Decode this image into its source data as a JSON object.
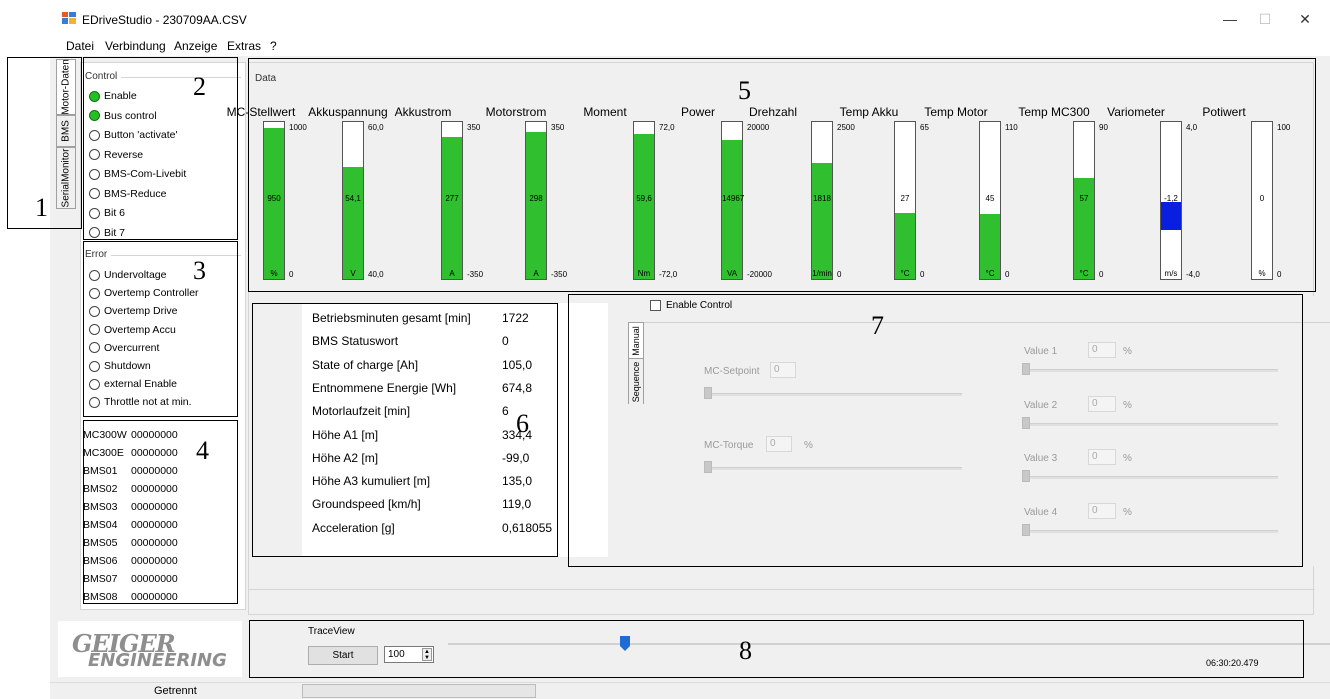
{
  "window": {
    "title": "EDriveStudio - 230709AA.CSV"
  },
  "window_controls": {
    "minimize": "—",
    "maximize": "☐",
    "close": "✕"
  },
  "menu": [
    "Datei",
    "Verbindung",
    "Anzeige",
    "Extras",
    "?"
  ],
  "side_tabs": [
    "Motor-Daten",
    "BMS",
    "SerialMonitor"
  ],
  "control": {
    "title": "Control",
    "items": [
      {
        "label": "Enable",
        "on": true
      },
      {
        "label": "Bus control",
        "on": true
      },
      {
        "label": "Button 'activate'",
        "on": false
      },
      {
        "label": "Reverse",
        "on": false
      },
      {
        "label": "BMS-Com-Livebit",
        "on": false
      },
      {
        "label": "BMS-Reduce",
        "on": false
      },
      {
        "label": "Bit 6",
        "on": false
      },
      {
        "label": "Bit 7",
        "on": false
      }
    ]
  },
  "error": {
    "title": "Error",
    "items": [
      "Undervoltage",
      "Overtemp Controller",
      "Overtemp Drive",
      "Overtemp Accu",
      "Overcurrent",
      "Shutdown",
      "external Enable",
      "Throttle not at min."
    ]
  },
  "registers": [
    {
      "name": "MC300W",
      "value": "00000000"
    },
    {
      "name": "MC300E",
      "value": "00000000"
    },
    {
      "name": "BMS01",
      "value": "00000000"
    },
    {
      "name": "BMS02",
      "value": "00000000"
    },
    {
      "name": "BMS03",
      "value": "00000000"
    },
    {
      "name": "BMS04",
      "value": "00000000"
    },
    {
      "name": "BMS05",
      "value": "00000000"
    },
    {
      "name": "BMS06",
      "value": "00000000"
    },
    {
      "name": "BMS07",
      "value": "00000000"
    },
    {
      "name": "BMS08",
      "value": "00000000"
    }
  ],
  "data_panel": {
    "title": "Data",
    "gauges": [
      {
        "label": "MC-Stellwert",
        "max": "1000",
        "min": "0",
        "value": "950",
        "unit": "%",
        "fraction": 0.95
      },
      {
        "label": "Akkuspannung",
        "max": "60,0",
        "min": "40,0",
        "value": "54,1",
        "unit": "V",
        "fraction": 0.705
      },
      {
        "label": "Akkustrom",
        "max": "350",
        "min": "-350",
        "value": "277",
        "unit": "A",
        "fraction": 0.896
      },
      {
        "label": "Motorstrom",
        "max": "350",
        "min": "-350",
        "value": "298",
        "unit": "A",
        "fraction": 0.926
      },
      {
        "label": "Moment",
        "max": "72,0",
        "min": "-72,0",
        "value": "59,6",
        "unit": "Nm",
        "fraction": 0.914
      },
      {
        "label": "Power",
        "max": "20000",
        "min": "-20000",
        "value": "14967",
        "unit": "VA",
        "fraction": 0.874
      },
      {
        "label": "Drehzahl",
        "max": "2500",
        "min": "0",
        "value": "1818",
        "unit": "1/min",
        "fraction": 0.727
      },
      {
        "label": "Temp Akku",
        "max": "65",
        "min": "0",
        "value": "27",
        "unit": "°C",
        "fraction": 0.415
      },
      {
        "label": "Temp Motor",
        "max": "110",
        "min": "0",
        "value": "45",
        "unit": "°C",
        "fraction": 0.409
      },
      {
        "label": "Temp MC300",
        "max": "90",
        "min": "0",
        "value": "57",
        "unit": "°C",
        "fraction": 0.633
      },
      {
        "label": "Variometer",
        "max": "4,0",
        "min": "-4,0",
        "value": "-1,2",
        "unit": "m/s",
        "fraction": -0.3
      },
      {
        "label": "Potiwert",
        "max": "100",
        "min": "0",
        "value": "0",
        "unit": "%",
        "fraction": 0
      }
    ]
  },
  "info": [
    {
      "label": "Betriebsminuten gesamt [min]",
      "value": "1722"
    },
    {
      "label": "BMS Statuswort",
      "value": "0"
    },
    {
      "label": "State of charge [Ah]",
      "value": "105,0"
    },
    {
      "label": "Entnommene Energie [Wh]",
      "value": "674,8"
    },
    {
      "label": "Motorlaufzeit [min]",
      "value": "6"
    },
    {
      "label": "Höhe A1 [m]",
      "value": "334,4"
    },
    {
      "label": "Höhe A2 [m]",
      "value": "-99,0"
    },
    {
      "label": "Höhe A3 kumuliert [m]",
      "value": "135,0"
    },
    {
      "label": "Groundspeed [km/h]",
      "value": "119,0"
    },
    {
      "label": "Acceleration [g]",
      "value": "0,618055"
    }
  ],
  "control_panel": {
    "enable_label": "Enable Control",
    "tabs": [
      "Manual",
      "Sequence"
    ],
    "mc_setpoint": {
      "label": "MC-Setpoint",
      "value": "0"
    },
    "mc_torque": {
      "label": "MC-Torque",
      "value": "0",
      "unit": "%"
    },
    "values": [
      {
        "label": "Value 1",
        "value": "0",
        "unit": "%"
      },
      {
        "label": "Value 2",
        "value": "0",
        "unit": "%"
      },
      {
        "label": "Value 3",
        "value": "0",
        "unit": "%"
      },
      {
        "label": "Value 4",
        "value": "0",
        "unit": "%"
      }
    ]
  },
  "trace": {
    "title": "TraceView",
    "start_label": "Start",
    "step_value": "100",
    "timestamp": "06:30:20.479",
    "position_fraction": 0.19
  },
  "logo": {
    "line1": "GEIGER",
    "line2": "ENGINEERING"
  },
  "status": {
    "text": "Getrennt"
  },
  "annotations": [
    "1",
    "2",
    "3",
    "4",
    "5",
    "6",
    "7",
    "8"
  ]
}
